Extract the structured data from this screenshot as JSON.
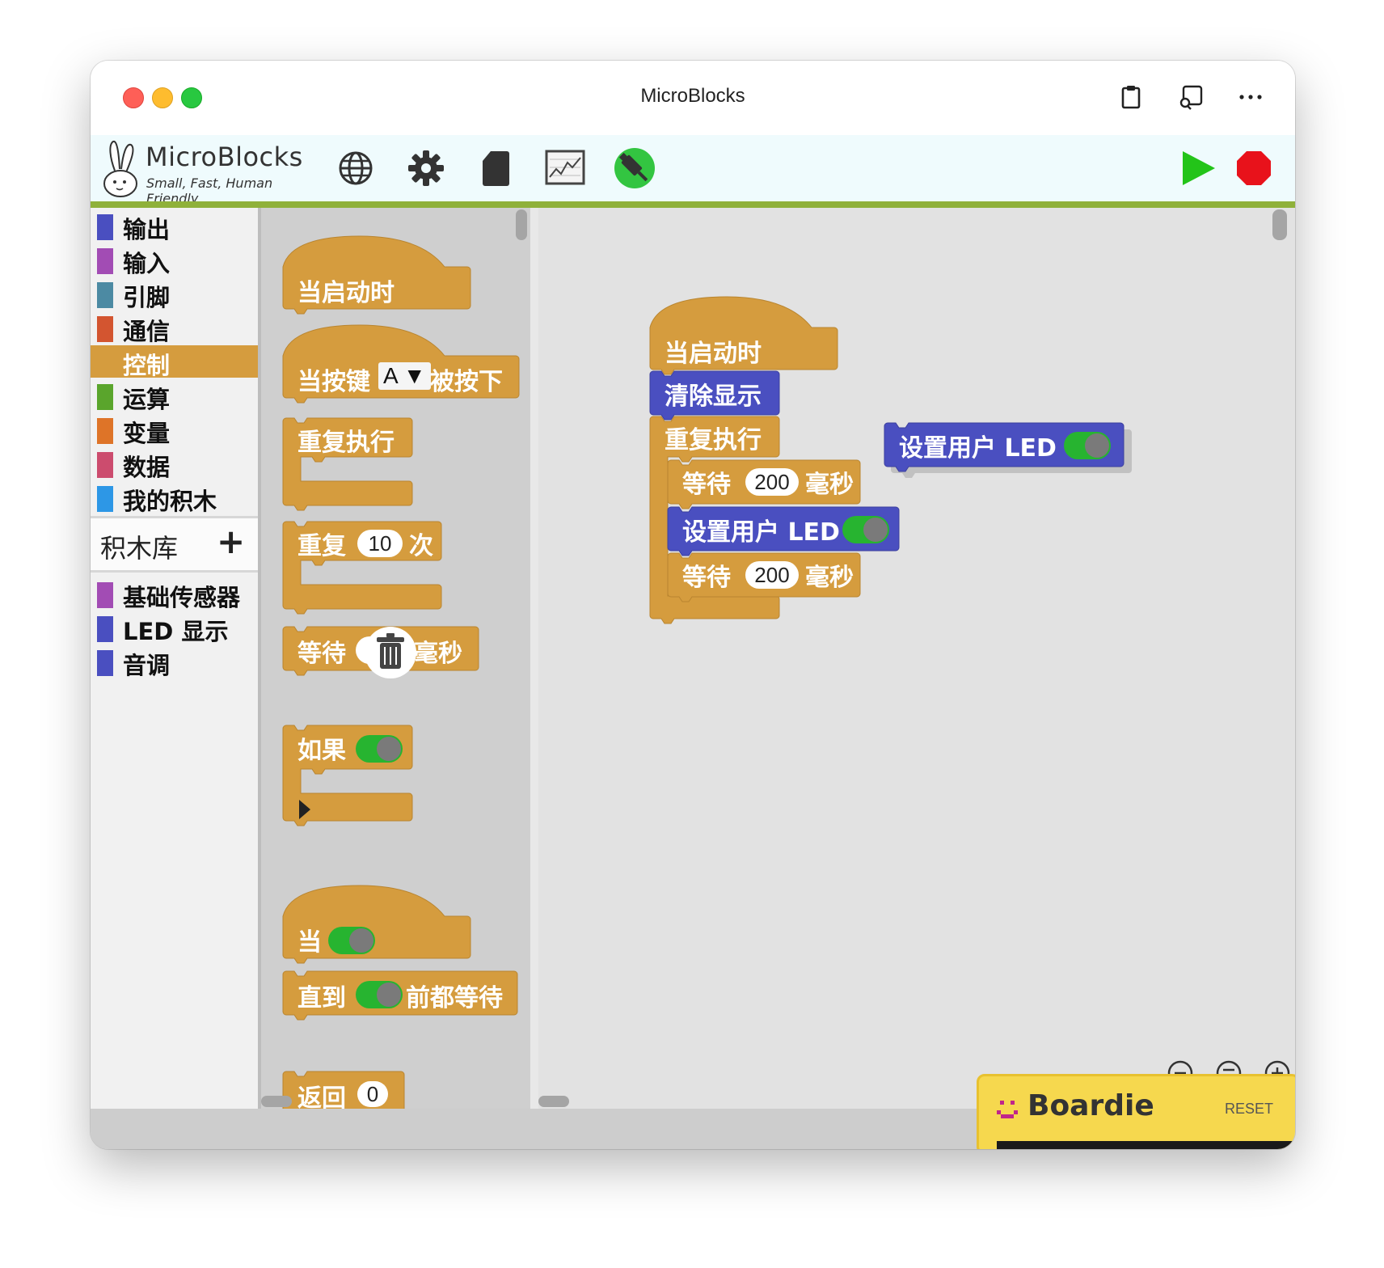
{
  "window": {
    "title": "MicroBlocks"
  },
  "titlebar_icons": [
    "clipboard-icon",
    "cast-icon",
    "more-icon"
  ],
  "toolbar": {
    "logo_name": "MicroBlocks",
    "logo_tagline": "Small, Fast, Human Friendly",
    "icons": [
      "globe-icon",
      "gear-icon",
      "file-icon",
      "graph-icon",
      "usb-connect-icon",
      "run-icon",
      "stop-icon"
    ]
  },
  "colors": {
    "control": "#d59c3e",
    "output_blue": "#4a4fc0",
    "toolbar_line": "#8fb13a"
  },
  "sidebar": {
    "categories": [
      {
        "label": "输出",
        "color": "#4a4fc0"
      },
      {
        "label": "输入",
        "color": "#a24cb4"
      },
      {
        "label": "引脚",
        "color": "#4c8aa3"
      },
      {
        "label": "通信",
        "color": "#d35530"
      },
      {
        "label": "控制",
        "color": "#d59c3e",
        "selected": true
      },
      {
        "label": "运算",
        "color": "#5aa52c"
      },
      {
        "label": "变量",
        "color": "#de7428"
      },
      {
        "label": "数据",
        "color": "#cc4c6e"
      },
      {
        "label": "我的积木",
        "color": "#2d97e6"
      }
    ],
    "library_header": "积木库",
    "library_add": "+",
    "libraries": [
      {
        "label": "基础传感器",
        "color": "#a24cb4"
      },
      {
        "label": "LED 显示",
        "color": "#4a4fc0"
      },
      {
        "label": "音调",
        "color": "#4a4fc0"
      }
    ]
  },
  "palette": {
    "when_started": "当启动时",
    "when_button_pre": "当按键",
    "when_button_option": "A",
    "when_button_post": "被按下",
    "forever": "重复执行",
    "repeat_pre": "重复",
    "repeat_count": "10",
    "repeat_post": "次",
    "wait_pre": "等待",
    "wait_post": "毫秒",
    "if": "如果",
    "when": "当",
    "wait_until_pre": "直到",
    "wait_until_post": "前都等待",
    "return": "返回",
    "return_value": "0"
  },
  "script": {
    "hat": "当启动时",
    "clear_display": "清除显示",
    "forever": "重复执行",
    "wait1_pre": "等待",
    "wait1_value": "200",
    "wait1_post": "毫秒",
    "set_led": "设置用户 LED",
    "wait2_pre": "等待",
    "wait2_value": "200",
    "wait2_post": "毫秒",
    "floating_set_led": "设置用户 LED"
  },
  "boardie": {
    "name": "Boardie",
    "reset": "RESET"
  }
}
